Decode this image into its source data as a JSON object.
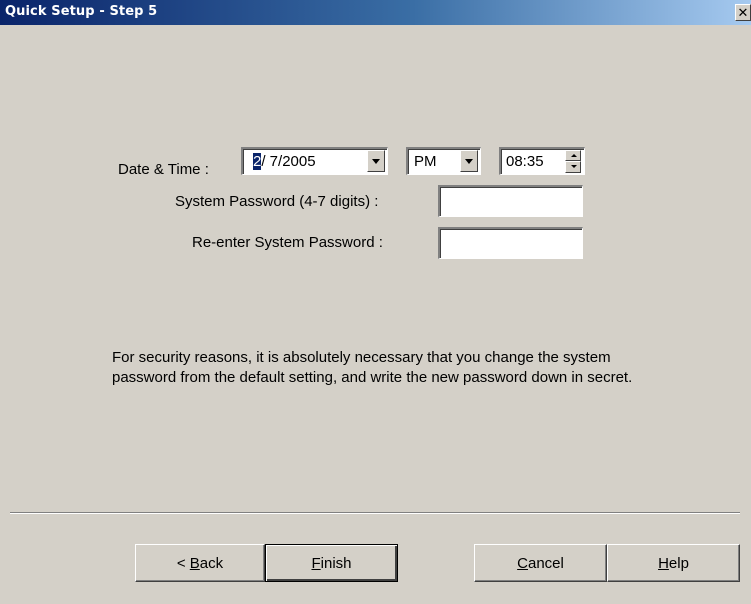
{
  "window": {
    "title": "Quick Setup - Step 5",
    "close_glyph": "✕"
  },
  "datetime": {
    "label": "Date & Time :",
    "date_selected_part": "2",
    "date_rest": "/  7/2005",
    "ampm_value": "PM",
    "time_value": "08:35"
  },
  "password": {
    "system_label": "System Password (4-7 digits) :",
    "system_value": "",
    "reenter_label": "Re-enter System Password :",
    "reenter_value": ""
  },
  "message": "For security reasons, it is absolutely necessary that you change the system password from the default setting, and write the new password down in secret.",
  "buttons": {
    "back_prefix": "< ",
    "back_mnemonic": "B",
    "back_rest": "ack",
    "finish_mnemonic": "F",
    "finish_rest": "inish",
    "cancel_mnemonic": "C",
    "cancel_rest": "ancel",
    "help_mnemonic": "H",
    "help_rest": "elp"
  },
  "colors": {
    "title_bar_start": "#0a246a",
    "title_bar_end": "#a6caf0",
    "dialog_face": "#d4d0c8",
    "selection": "#0a246a"
  },
  "icons": {
    "close": "close-icon",
    "dropdown": "chevron-down-icon",
    "spin_up": "spin-up-icon",
    "spin_down": "spin-down-icon"
  }
}
